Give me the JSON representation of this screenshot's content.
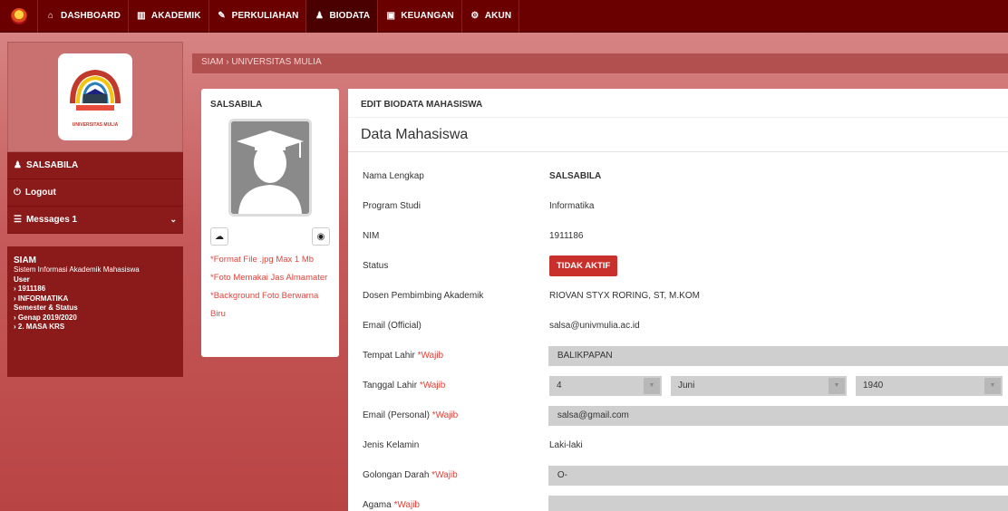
{
  "nav": {
    "items": [
      {
        "label": "DASHBOARD",
        "icon": "home-icon",
        "glyph": "⌂"
      },
      {
        "label": "AKADEMIK",
        "icon": "bank-icon",
        "glyph": "▥"
      },
      {
        "label": "PERKULIAHAN",
        "icon": "pencil-icon",
        "glyph": "✎"
      },
      {
        "label": "BIODATA",
        "icon": "user-icon",
        "glyph": "♟"
      },
      {
        "label": "KEUANGAN",
        "icon": "money-icon",
        "glyph": "▣"
      },
      {
        "label": "AKUN",
        "icon": "gears-icon",
        "glyph": "⚙"
      }
    ]
  },
  "sidebar": {
    "logo_caption": "UNIVERSITAS MULIA",
    "user": "SALSABILA",
    "logout": "Logout",
    "messages": "Messages 1",
    "info": {
      "title": "SIAM",
      "subtitle": "Sistem Informasi Akademik Mahasiswa",
      "user_label": "User",
      "nim": "› 1911186",
      "prodi": "› INFORMATIKA",
      "semester_label": "Semester & Status",
      "semester": "› Genap 2019/2020",
      "status": "› 2. MASA KRS"
    }
  },
  "breadcrumb": "SIAM  ›  UNIVERSITAS MULIA",
  "profile": {
    "name": "SALSABILA",
    "notes": [
      "*Format File .jpg Max 1 Mb",
      "*Foto Memakai Jas Almamater",
      "*Background Foto Berwarna Biru"
    ]
  },
  "main": {
    "header": "EDIT BIODATA MAHASISWA",
    "section": "Data Mahasiswa",
    "wajib": "*Wajib",
    "fields": {
      "nama_label": "Nama Lengkap",
      "nama": "SALSABILA",
      "prodi_label": "Program Studi",
      "prodi": "Informatika",
      "nim_label": "NIM",
      "nim": "1911186",
      "status_label": "Status",
      "status": "TIDAK AKTIF",
      "dosen_label": "Dosen Pembimbing Akademik",
      "dosen": "RIOVAN STYX RORING, ST, M.KOM",
      "email_off_label": "Email (Official)",
      "email_off": "salsa@univmulia.ac.id",
      "tempat_label": "Tempat Lahir",
      "tempat": "BALIKPAPAN",
      "tanggal_label": "Tanggal Lahir",
      "tgl_day": "4",
      "tgl_month": "Juni",
      "tgl_year": "1940",
      "email_pers_label": "Email (Personal)",
      "email_pers": "salsa@gmail.com",
      "jk_label": "Jenis Kelamin",
      "jk": "Laki-laki",
      "goldar_label": "Golongan Darah",
      "goldar": "O-",
      "agama_label": "Agama"
    }
  },
  "colors": {
    "navbar": "#6a0000",
    "sidebar": "#8b1a1a",
    "badge": "#c9302c",
    "required": "#e2433b"
  }
}
